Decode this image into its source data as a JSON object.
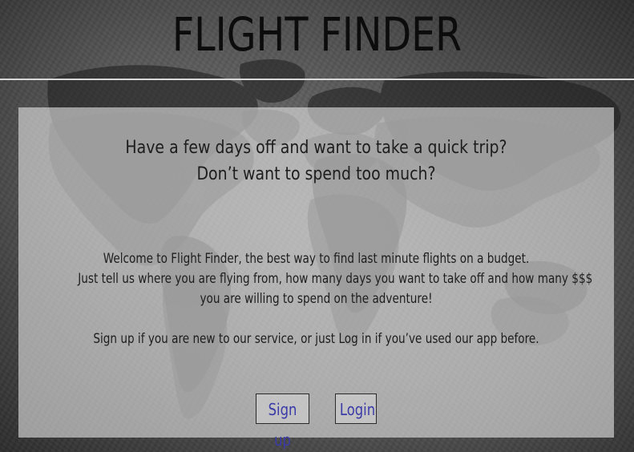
{
  "header": {
    "title": "FLIGHT FINDER"
  },
  "hero": {
    "headline_lines": [
      "Have a few days off and want to take a quick trip?",
      "Don’t want to spend too much?"
    ],
    "intro_lines": [
      "Welcome to Flight Finder, the best way to find last minute flights on a budget.",
      "Just tell us where you are flying from, how many days you want to take off and how many $$$",
      "you are willing to spend on the adventure!"
    ],
    "cta_text": "Sign up if you are new to our service, or just Log in if you’ve used our app before."
  },
  "actions": {
    "signup_label": "Sign up",
    "login_label": "Login"
  },
  "colors": {
    "title": "#0c0c0c",
    "text": "#1d1d1d",
    "link": "#3a3aa8",
    "panel": "#ececec"
  }
}
